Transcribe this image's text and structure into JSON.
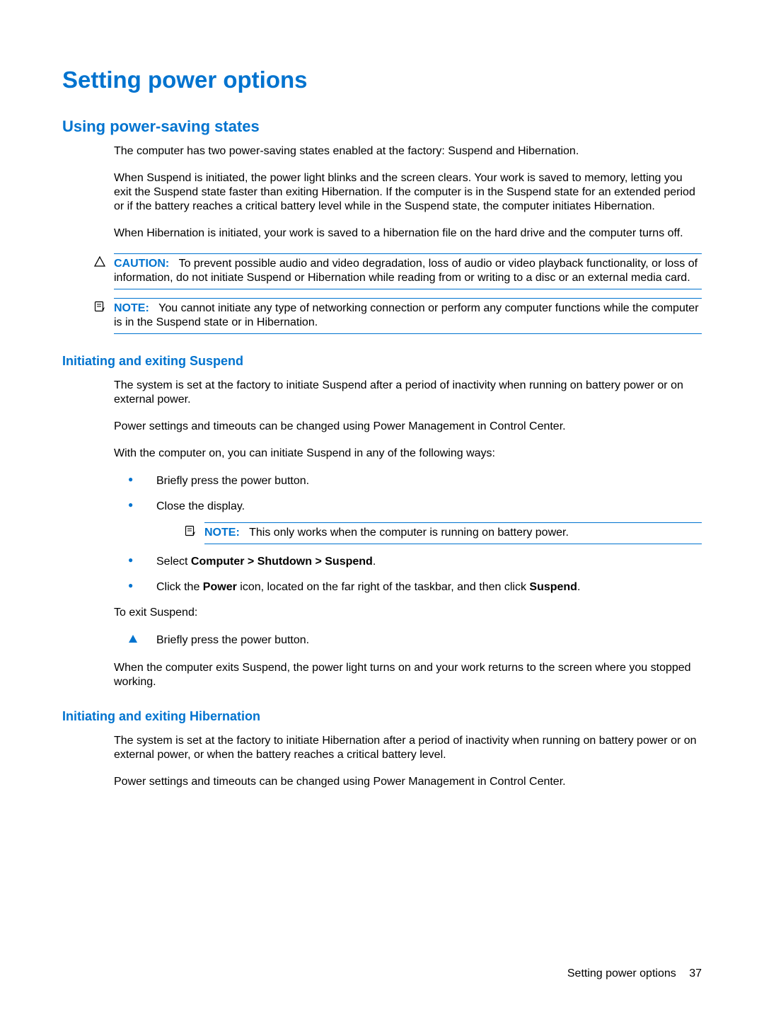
{
  "h1": "Setting power options",
  "h2": "Using power-saving states",
  "intro_p1": "The computer has two power-saving states enabled at the factory: Suspend and Hibernation.",
  "intro_p2": "When Suspend is initiated, the power light blinks and the screen clears. Your work is saved to memory, letting you exit the Suspend state faster than exiting Hibernation. If the computer is in the Suspend state for an extended period or if the battery reaches a critical battery level while in the Suspend state, the computer initiates Hibernation.",
  "intro_p3": "When Hibernation is initiated, your work is saved to a hibernation file on the hard drive and the computer turns off.",
  "caution_label": "CAUTION:",
  "caution_body": "To prevent possible audio and video degradation, loss of audio or video playback functionality, or loss of information, do not initiate Suspend or Hibernation while reading from or writing to a disc or an external media card.",
  "note1_label": "NOTE:",
  "note1_body": "You cannot initiate any type of networking connection or perform any computer functions while the computer is in the Suspend state or in Hibernation.",
  "h3_suspend": "Initiating and exiting Suspend",
  "suspend_p1": "The system is set at the factory to initiate Suspend after a period of inactivity when running on battery power or on external power.",
  "suspend_p2": "Power settings and timeouts can be changed using Power Management in Control Center.",
  "suspend_p3": "With the computer on, you can initiate Suspend in any of the following ways:",
  "bullets": {
    "b1": "Briefly press the power button.",
    "b2": "Close the display.",
    "b2_note_label": "NOTE:",
    "b2_note_body": "This only works when the computer is running on battery power.",
    "b3_pre": "Select ",
    "b3_bold": "Computer > Shutdown > Suspend",
    "b3_post": ".",
    "b4_pre": "Click the ",
    "b4_bold1": "Power",
    "b4_mid": " icon, located on the far right of the taskbar, and then click ",
    "b4_bold2": "Suspend",
    "b4_post": "."
  },
  "suspend_exit_intro": "To exit Suspend:",
  "suspend_exit_step": "Briefly press the power button.",
  "suspend_outro": "When the computer exits Suspend, the power light turns on and your work returns to the screen where you stopped working.",
  "h3_hibernation": "Initiating and exiting Hibernation",
  "hib_p1": "The system is set at the factory to initiate Hibernation after a period of inactivity when running on battery power or on external power, or when the battery reaches a critical battery level.",
  "hib_p2": "Power settings and timeouts can be changed using Power Management in Control Center.",
  "footer_text": "Setting power options",
  "footer_page": "37"
}
